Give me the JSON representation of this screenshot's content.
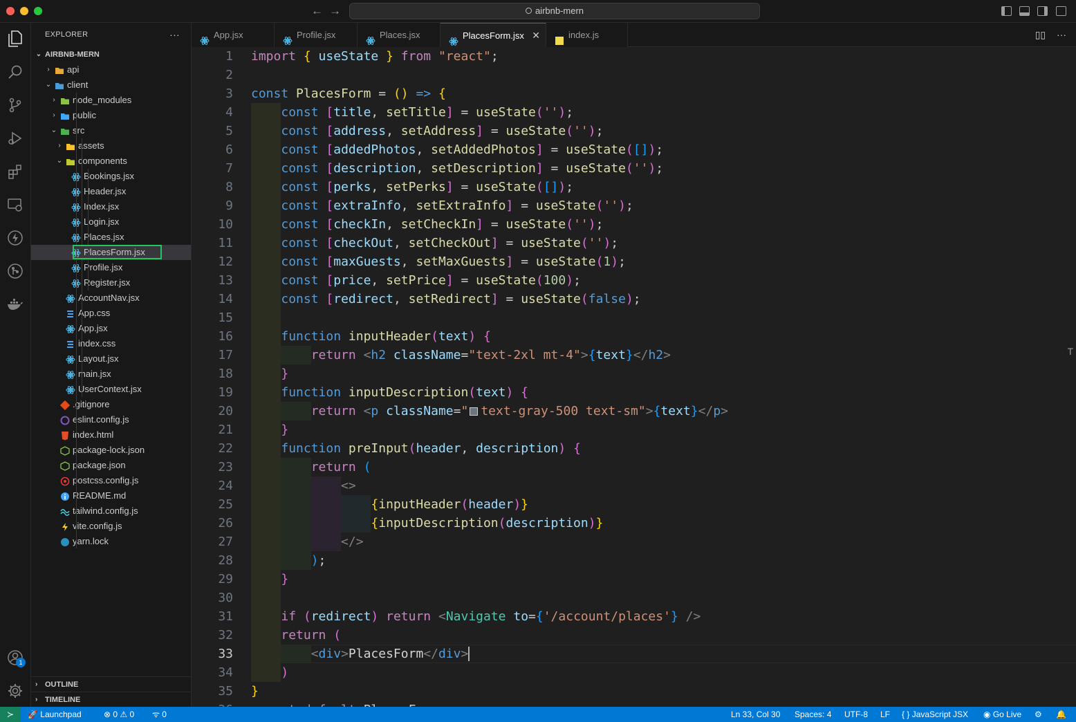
{
  "window": {
    "search_text": "airbnb-mern"
  },
  "sidebar": {
    "title": "EXPLORER",
    "root": "AIRBNB-MERN",
    "tree": [
      {
        "label": "api",
        "depth": 1,
        "kind": "folder",
        "expanded": false,
        "icon_color": "#e8a93a"
      },
      {
        "label": "client",
        "depth": 1,
        "kind": "folder",
        "expanded": true,
        "icon_color": "#4a9bd6"
      },
      {
        "label": "node_modules",
        "depth": 2,
        "kind": "folder",
        "expanded": false,
        "icon_color": "#8bc34a"
      },
      {
        "label": "public",
        "depth": 2,
        "kind": "folder",
        "expanded": false,
        "icon_color": "#42a5f5"
      },
      {
        "label": "src",
        "depth": 2,
        "kind": "folder",
        "expanded": true,
        "icon_color": "#4caf50"
      },
      {
        "label": "assets",
        "depth": 3,
        "kind": "folder",
        "expanded": false,
        "icon_color": "#fbc02d"
      },
      {
        "label": "components",
        "depth": 3,
        "kind": "folder",
        "expanded": true,
        "icon_color": "#c0ca33"
      },
      {
        "label": "Bookings.jsx",
        "depth": 4,
        "kind": "react"
      },
      {
        "label": "Header.jsx",
        "depth": 4,
        "kind": "react"
      },
      {
        "label": "Index.jsx",
        "depth": 4,
        "kind": "react"
      },
      {
        "label": "Login.jsx",
        "depth": 4,
        "kind": "react"
      },
      {
        "label": "Places.jsx",
        "depth": 4,
        "kind": "react"
      },
      {
        "label": "PlacesForm.jsx",
        "depth": 4,
        "kind": "react",
        "selected": true
      },
      {
        "label": "Profile.jsx",
        "depth": 4,
        "kind": "react"
      },
      {
        "label": "Register.jsx",
        "depth": 4,
        "kind": "react"
      },
      {
        "label": "AccountNav.jsx",
        "depth": 3,
        "kind": "react"
      },
      {
        "label": "App.css",
        "depth": 3,
        "kind": "css"
      },
      {
        "label": "App.jsx",
        "depth": 3,
        "kind": "react"
      },
      {
        "label": "index.css",
        "depth": 3,
        "kind": "css"
      },
      {
        "label": "Layout.jsx",
        "depth": 3,
        "kind": "react"
      },
      {
        "label": "main.jsx",
        "depth": 3,
        "kind": "react"
      },
      {
        "label": "UserContext.jsx",
        "depth": 3,
        "kind": "react"
      },
      {
        "label": ".gitignore",
        "depth": 2,
        "kind": "git"
      },
      {
        "label": "eslint.config.js",
        "depth": 2,
        "kind": "eslint"
      },
      {
        "label": "index.html",
        "depth": 2,
        "kind": "html"
      },
      {
        "label": "package-lock.json",
        "depth": 2,
        "kind": "npm"
      },
      {
        "label": "package.json",
        "depth": 2,
        "kind": "npm"
      },
      {
        "label": "postcss.config.js",
        "depth": 2,
        "kind": "postcss"
      },
      {
        "label": "README.md",
        "depth": 2,
        "kind": "info"
      },
      {
        "label": "tailwind.config.js",
        "depth": 2,
        "kind": "tailwind"
      },
      {
        "label": "vite.config.js",
        "depth": 2,
        "kind": "vite"
      },
      {
        "label": "yarn.lock",
        "depth": 2,
        "kind": "yarn"
      }
    ],
    "outline_label": "OUTLINE",
    "timeline_label": "TIMELINE"
  },
  "tabs": [
    {
      "label": "App.jsx",
      "kind": "react"
    },
    {
      "label": "Profile.jsx",
      "kind": "react"
    },
    {
      "label": "Places.jsx",
      "kind": "react"
    },
    {
      "label": "PlacesForm.jsx",
      "kind": "react",
      "active": true
    },
    {
      "label": "index.js",
      "kind": "js"
    }
  ],
  "editor": {
    "current_line": 33,
    "lines": [
      [
        [
          "kw2",
          "import "
        ],
        [
          "br1",
          "{ "
        ],
        [
          "var",
          "useState"
        ],
        [
          "br1",
          " }"
        ],
        [
          "kw2",
          " from "
        ],
        [
          "str",
          "\"react\""
        ],
        [
          "plain",
          ";"
        ]
      ],
      [],
      [
        [
          "kw",
          "const "
        ],
        [
          "fn",
          "PlacesForm"
        ],
        [
          "plain",
          " = "
        ],
        [
          "br1",
          "()"
        ],
        [
          "kw",
          " => "
        ],
        [
          "br1",
          "{"
        ]
      ],
      [
        [
          "plain",
          "    "
        ],
        [
          "kw",
          "const "
        ],
        [
          "br2",
          "["
        ],
        [
          "var",
          "title"
        ],
        [
          "plain",
          ", "
        ],
        [
          "fn",
          "setTitle"
        ],
        [
          "br2",
          "]"
        ],
        [
          "plain",
          " = "
        ],
        [
          "fn",
          "useState"
        ],
        [
          "br2",
          "("
        ],
        [
          "str",
          "''"
        ],
        [
          "br2",
          ")"
        ],
        [
          "plain",
          ";"
        ]
      ],
      [
        [
          "plain",
          "    "
        ],
        [
          "kw",
          "const "
        ],
        [
          "br2",
          "["
        ],
        [
          "var",
          "address"
        ],
        [
          "plain",
          ", "
        ],
        [
          "fn",
          "setAddress"
        ],
        [
          "br2",
          "]"
        ],
        [
          "plain",
          " = "
        ],
        [
          "fn",
          "useState"
        ],
        [
          "br2",
          "("
        ],
        [
          "str",
          "''"
        ],
        [
          "br2",
          ")"
        ],
        [
          "plain",
          ";"
        ]
      ],
      [
        [
          "plain",
          "    "
        ],
        [
          "kw",
          "const "
        ],
        [
          "br2",
          "["
        ],
        [
          "var",
          "addedPhotos"
        ],
        [
          "plain",
          ", "
        ],
        [
          "fn",
          "setAddedPhotos"
        ],
        [
          "br2",
          "]"
        ],
        [
          "plain",
          " = "
        ],
        [
          "fn",
          "useState"
        ],
        [
          "br2",
          "("
        ],
        [
          "br3",
          "[]"
        ],
        [
          "br2",
          ")"
        ],
        [
          "plain",
          ";"
        ]
      ],
      [
        [
          "plain",
          "    "
        ],
        [
          "kw",
          "const "
        ],
        [
          "br2",
          "["
        ],
        [
          "var",
          "description"
        ],
        [
          "plain",
          ", "
        ],
        [
          "fn",
          "setDescription"
        ],
        [
          "br2",
          "]"
        ],
        [
          "plain",
          " = "
        ],
        [
          "fn",
          "useState"
        ],
        [
          "br2",
          "("
        ],
        [
          "str",
          "''"
        ],
        [
          "br2",
          ")"
        ],
        [
          "plain",
          ";"
        ]
      ],
      [
        [
          "plain",
          "    "
        ],
        [
          "kw",
          "const "
        ],
        [
          "br2",
          "["
        ],
        [
          "var",
          "perks"
        ],
        [
          "plain",
          ", "
        ],
        [
          "fn",
          "setPerks"
        ],
        [
          "br2",
          "]"
        ],
        [
          "plain",
          " = "
        ],
        [
          "fn",
          "useState"
        ],
        [
          "br2",
          "("
        ],
        [
          "br3",
          "[]"
        ],
        [
          "br2",
          ")"
        ],
        [
          "plain",
          ";"
        ]
      ],
      [
        [
          "plain",
          "    "
        ],
        [
          "kw",
          "const "
        ],
        [
          "br2",
          "["
        ],
        [
          "var",
          "extraInfo"
        ],
        [
          "plain",
          ", "
        ],
        [
          "fn",
          "setExtraInfo"
        ],
        [
          "br2",
          "]"
        ],
        [
          "plain",
          " = "
        ],
        [
          "fn",
          "useState"
        ],
        [
          "br2",
          "("
        ],
        [
          "str",
          "''"
        ],
        [
          "br2",
          ")"
        ],
        [
          "plain",
          ";"
        ]
      ],
      [
        [
          "plain",
          "    "
        ],
        [
          "kw",
          "const "
        ],
        [
          "br2",
          "["
        ],
        [
          "var",
          "checkIn"
        ],
        [
          "plain",
          ", "
        ],
        [
          "fn",
          "setCheckIn"
        ],
        [
          "br2",
          "]"
        ],
        [
          "plain",
          " = "
        ],
        [
          "fn",
          "useState"
        ],
        [
          "br2",
          "("
        ],
        [
          "str",
          "''"
        ],
        [
          "br2",
          ")"
        ],
        [
          "plain",
          ";"
        ]
      ],
      [
        [
          "plain",
          "    "
        ],
        [
          "kw",
          "const "
        ],
        [
          "br2",
          "["
        ],
        [
          "var",
          "checkOut"
        ],
        [
          "plain",
          ", "
        ],
        [
          "fn",
          "setCheckOut"
        ],
        [
          "br2",
          "]"
        ],
        [
          "plain",
          " = "
        ],
        [
          "fn",
          "useState"
        ],
        [
          "br2",
          "("
        ],
        [
          "str",
          "''"
        ],
        [
          "br2",
          ")"
        ],
        [
          "plain",
          ";"
        ]
      ],
      [
        [
          "plain",
          "    "
        ],
        [
          "kw",
          "const "
        ],
        [
          "br2",
          "["
        ],
        [
          "var",
          "maxGuests"
        ],
        [
          "plain",
          ", "
        ],
        [
          "fn",
          "setMaxGuests"
        ],
        [
          "br2",
          "]"
        ],
        [
          "plain",
          " = "
        ],
        [
          "fn",
          "useState"
        ],
        [
          "br2",
          "("
        ],
        [
          "num",
          "1"
        ],
        [
          "br2",
          ")"
        ],
        [
          "plain",
          ";"
        ]
      ],
      [
        [
          "plain",
          "    "
        ],
        [
          "kw",
          "const "
        ],
        [
          "br2",
          "["
        ],
        [
          "var",
          "price"
        ],
        [
          "plain",
          ", "
        ],
        [
          "fn",
          "setPrice"
        ],
        [
          "br2",
          "]"
        ],
        [
          "plain",
          " = "
        ],
        [
          "fn",
          "useState"
        ],
        [
          "br2",
          "("
        ],
        [
          "num",
          "100"
        ],
        [
          "br2",
          ")"
        ],
        [
          "plain",
          ";"
        ]
      ],
      [
        [
          "plain",
          "    "
        ],
        [
          "kw",
          "const "
        ],
        [
          "br2",
          "["
        ],
        [
          "var",
          "redirect"
        ],
        [
          "plain",
          ", "
        ],
        [
          "fn",
          "setRedirect"
        ],
        [
          "br2",
          "]"
        ],
        [
          "plain",
          " = "
        ],
        [
          "fn",
          "useState"
        ],
        [
          "br2",
          "("
        ],
        [
          "kw",
          "false"
        ],
        [
          "br2",
          ")"
        ],
        [
          "plain",
          ";"
        ]
      ],
      [],
      [
        [
          "plain",
          "    "
        ],
        [
          "kw",
          "function "
        ],
        [
          "fn",
          "inputHeader"
        ],
        [
          "br2",
          "("
        ],
        [
          "var",
          "text"
        ],
        [
          "br2",
          ")"
        ],
        [
          "br2",
          " {"
        ]
      ],
      [
        [
          "plain",
          "        "
        ],
        [
          "kw2",
          "return "
        ],
        [
          "tagpunc",
          "<"
        ],
        [
          "tag",
          "h2"
        ],
        [
          "attr",
          " className"
        ],
        [
          "plain",
          "="
        ],
        [
          "str",
          "\"text-2xl mt-4\""
        ],
        [
          "tagpunc",
          ">"
        ],
        [
          "br3",
          "{"
        ],
        [
          "var",
          "text"
        ],
        [
          "br3",
          "}"
        ],
        [
          "tagpunc",
          "</"
        ],
        [
          "tag",
          "h2"
        ],
        [
          "tagpunc",
          ">"
        ]
      ],
      [
        [
          "plain",
          "    "
        ],
        [
          "br2",
          "}"
        ]
      ],
      [
        [
          "plain",
          "    "
        ],
        [
          "kw",
          "function "
        ],
        [
          "fn",
          "inputDescription"
        ],
        [
          "br2",
          "("
        ],
        [
          "var",
          "text"
        ],
        [
          "br2",
          ")"
        ],
        [
          "br2",
          " {"
        ]
      ],
      [
        [
          "plain",
          "        "
        ],
        [
          "kw2",
          "return "
        ],
        [
          "tagpunc",
          "<"
        ],
        [
          "tag",
          "p"
        ],
        [
          "attr",
          " className"
        ],
        [
          "plain",
          "="
        ],
        [
          "str",
          "\""
        ],
        [
          "swatch",
          ""
        ],
        [
          "str",
          "text-gray-500 text-sm\""
        ],
        [
          "tagpunc",
          ">"
        ],
        [
          "br3",
          "{"
        ],
        [
          "var",
          "text"
        ],
        [
          "br3",
          "}"
        ],
        [
          "tagpunc",
          "</"
        ],
        [
          "tag",
          "p"
        ],
        [
          "tagpunc",
          ">"
        ]
      ],
      [
        [
          "plain",
          "    "
        ],
        [
          "br2",
          "}"
        ]
      ],
      [
        [
          "plain",
          "    "
        ],
        [
          "kw",
          "function "
        ],
        [
          "fn",
          "preInput"
        ],
        [
          "br2",
          "("
        ],
        [
          "var",
          "header"
        ],
        [
          "plain",
          ", "
        ],
        [
          "var",
          "description"
        ],
        [
          "br2",
          ")"
        ],
        [
          "br2",
          " {"
        ]
      ],
      [
        [
          "plain",
          "        "
        ],
        [
          "kw2",
          "return "
        ],
        [
          "br3",
          "("
        ]
      ],
      [
        [
          "plain",
          "            "
        ],
        [
          "tagpunc",
          "<>"
        ]
      ],
      [
        [
          "plain",
          "                "
        ],
        [
          "br1",
          "{"
        ],
        [
          "fn",
          "inputHeader"
        ],
        [
          "br2",
          "("
        ],
        [
          "var",
          "header"
        ],
        [
          "br2",
          ")"
        ],
        [
          "br1",
          "}"
        ]
      ],
      [
        [
          "plain",
          "                "
        ],
        [
          "br1",
          "{"
        ],
        [
          "fn",
          "inputDescription"
        ],
        [
          "br2",
          "("
        ],
        [
          "var",
          "description"
        ],
        [
          "br2",
          ")"
        ],
        [
          "br1",
          "}"
        ]
      ],
      [
        [
          "plain",
          "            "
        ],
        [
          "tagpunc",
          "</>"
        ]
      ],
      [
        [
          "plain",
          "        "
        ],
        [
          "br3",
          ")"
        ],
        [
          "plain",
          ";"
        ]
      ],
      [
        [
          "plain",
          "    "
        ],
        [
          "br2",
          "}"
        ]
      ],
      [],
      [
        [
          "plain",
          "    "
        ],
        [
          "kw2",
          "if "
        ],
        [
          "br2",
          "("
        ],
        [
          "var",
          "redirect"
        ],
        [
          "br2",
          ")"
        ],
        [
          "kw2",
          " return "
        ],
        [
          "tagpunc",
          "<"
        ],
        [
          "comp",
          "Navigate"
        ],
        [
          "attr",
          " to"
        ],
        [
          "plain",
          "="
        ],
        [
          "br3",
          "{"
        ],
        [
          "str",
          "'/account/places'"
        ],
        [
          "br3",
          "}"
        ],
        [
          "tagpunc",
          " />"
        ]
      ],
      [
        [
          "plain",
          "    "
        ],
        [
          "kw2",
          "return "
        ],
        [
          "br2",
          "("
        ]
      ],
      [
        [
          "plain",
          "        "
        ],
        [
          "tagpunc",
          "<"
        ],
        [
          "tag",
          "div"
        ],
        [
          "tagpunc",
          ">"
        ],
        [
          "jsxtext",
          "PlacesForm"
        ],
        [
          "tagpunc",
          "</"
        ],
        [
          "tag",
          "div"
        ],
        [
          "tagpunc",
          ">"
        ]
      ],
      [
        [
          "plain",
          "    "
        ],
        [
          "br2",
          ")"
        ]
      ],
      [
        [
          "br1",
          "}"
        ]
      ],
      [
        [
          "kw2",
          "export default "
        ],
        [
          "plain",
          "PlacesForm"
        ]
      ]
    ]
  },
  "statusbar": {
    "launchpad": "Launchpad",
    "errors": "0",
    "warnings": "0",
    "ports": "0",
    "position": "Ln 33, Col 30",
    "spaces": "Spaces: 4",
    "encoding": "UTF-8",
    "eol": "LF",
    "language": "JavaScript JSX",
    "golive": "Go Live"
  },
  "colors": {
    "accent": "#0078d4",
    "selection_outline": "#22c55e"
  }
}
